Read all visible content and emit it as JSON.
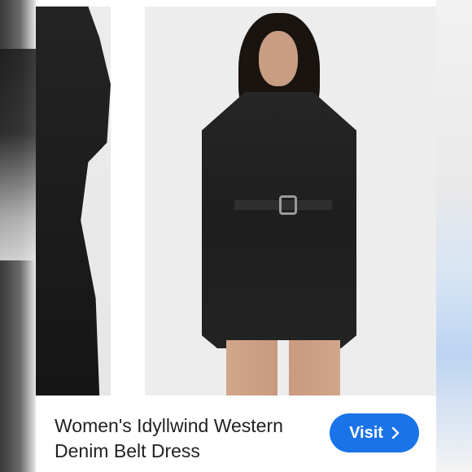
{
  "product": {
    "title_line1": "Women's Idyllwind Western",
    "title_line2": "Denim Belt Dress"
  },
  "actions": {
    "visit_label": "Visit",
    "visit_icon": "chevron-right-icon"
  },
  "colors": {
    "button_blue": "#1a73e8",
    "title_text": "#222222",
    "card_bg": "#ffffff",
    "dress": "#1e1e1e"
  }
}
